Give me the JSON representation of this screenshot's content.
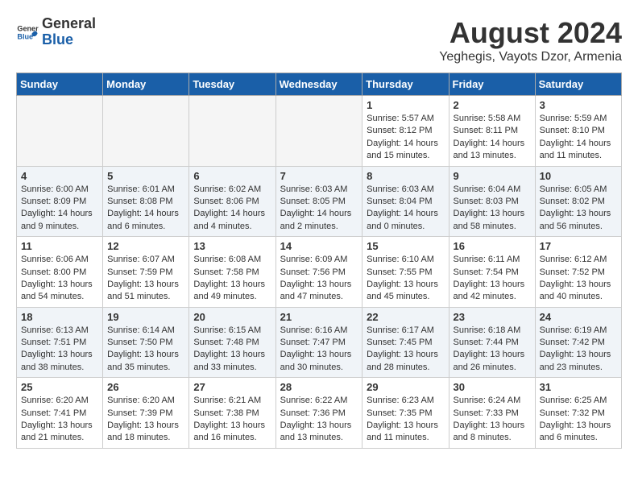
{
  "header": {
    "logo_general": "General",
    "logo_blue": "Blue",
    "title": "August 2024",
    "subtitle": "Yeghegis, Vayots Dzor, Armenia"
  },
  "weekdays": [
    "Sunday",
    "Monday",
    "Tuesday",
    "Wednesday",
    "Thursday",
    "Friday",
    "Saturday"
  ],
  "weeks": [
    [
      {
        "day": "",
        "info": ""
      },
      {
        "day": "",
        "info": ""
      },
      {
        "day": "",
        "info": ""
      },
      {
        "day": "",
        "info": ""
      },
      {
        "day": "1",
        "info": "Sunrise: 5:57 AM\nSunset: 8:12 PM\nDaylight: 14 hours and 15 minutes."
      },
      {
        "day": "2",
        "info": "Sunrise: 5:58 AM\nSunset: 8:11 PM\nDaylight: 14 hours and 13 minutes."
      },
      {
        "day": "3",
        "info": "Sunrise: 5:59 AM\nSunset: 8:10 PM\nDaylight: 14 hours and 11 minutes."
      }
    ],
    [
      {
        "day": "4",
        "info": "Sunrise: 6:00 AM\nSunset: 8:09 PM\nDaylight: 14 hours and 9 minutes."
      },
      {
        "day": "5",
        "info": "Sunrise: 6:01 AM\nSunset: 8:08 PM\nDaylight: 14 hours and 6 minutes."
      },
      {
        "day": "6",
        "info": "Sunrise: 6:02 AM\nSunset: 8:06 PM\nDaylight: 14 hours and 4 minutes."
      },
      {
        "day": "7",
        "info": "Sunrise: 6:03 AM\nSunset: 8:05 PM\nDaylight: 14 hours and 2 minutes."
      },
      {
        "day": "8",
        "info": "Sunrise: 6:03 AM\nSunset: 8:04 PM\nDaylight: 14 hours and 0 minutes."
      },
      {
        "day": "9",
        "info": "Sunrise: 6:04 AM\nSunset: 8:03 PM\nDaylight: 13 hours and 58 minutes."
      },
      {
        "day": "10",
        "info": "Sunrise: 6:05 AM\nSunset: 8:02 PM\nDaylight: 13 hours and 56 minutes."
      }
    ],
    [
      {
        "day": "11",
        "info": "Sunrise: 6:06 AM\nSunset: 8:00 PM\nDaylight: 13 hours and 54 minutes."
      },
      {
        "day": "12",
        "info": "Sunrise: 6:07 AM\nSunset: 7:59 PM\nDaylight: 13 hours and 51 minutes."
      },
      {
        "day": "13",
        "info": "Sunrise: 6:08 AM\nSunset: 7:58 PM\nDaylight: 13 hours and 49 minutes."
      },
      {
        "day": "14",
        "info": "Sunrise: 6:09 AM\nSunset: 7:56 PM\nDaylight: 13 hours and 47 minutes."
      },
      {
        "day": "15",
        "info": "Sunrise: 6:10 AM\nSunset: 7:55 PM\nDaylight: 13 hours and 45 minutes."
      },
      {
        "day": "16",
        "info": "Sunrise: 6:11 AM\nSunset: 7:54 PM\nDaylight: 13 hours and 42 minutes."
      },
      {
        "day": "17",
        "info": "Sunrise: 6:12 AM\nSunset: 7:52 PM\nDaylight: 13 hours and 40 minutes."
      }
    ],
    [
      {
        "day": "18",
        "info": "Sunrise: 6:13 AM\nSunset: 7:51 PM\nDaylight: 13 hours and 38 minutes."
      },
      {
        "day": "19",
        "info": "Sunrise: 6:14 AM\nSunset: 7:50 PM\nDaylight: 13 hours and 35 minutes."
      },
      {
        "day": "20",
        "info": "Sunrise: 6:15 AM\nSunset: 7:48 PM\nDaylight: 13 hours and 33 minutes."
      },
      {
        "day": "21",
        "info": "Sunrise: 6:16 AM\nSunset: 7:47 PM\nDaylight: 13 hours and 30 minutes."
      },
      {
        "day": "22",
        "info": "Sunrise: 6:17 AM\nSunset: 7:45 PM\nDaylight: 13 hours and 28 minutes."
      },
      {
        "day": "23",
        "info": "Sunrise: 6:18 AM\nSunset: 7:44 PM\nDaylight: 13 hours and 26 minutes."
      },
      {
        "day": "24",
        "info": "Sunrise: 6:19 AM\nSunset: 7:42 PM\nDaylight: 13 hours and 23 minutes."
      }
    ],
    [
      {
        "day": "25",
        "info": "Sunrise: 6:20 AM\nSunset: 7:41 PM\nDaylight: 13 hours and 21 minutes."
      },
      {
        "day": "26",
        "info": "Sunrise: 6:20 AM\nSunset: 7:39 PM\nDaylight: 13 hours and 18 minutes."
      },
      {
        "day": "27",
        "info": "Sunrise: 6:21 AM\nSunset: 7:38 PM\nDaylight: 13 hours and 16 minutes."
      },
      {
        "day": "28",
        "info": "Sunrise: 6:22 AM\nSunset: 7:36 PM\nDaylight: 13 hours and 13 minutes."
      },
      {
        "day": "29",
        "info": "Sunrise: 6:23 AM\nSunset: 7:35 PM\nDaylight: 13 hours and 11 minutes."
      },
      {
        "day": "30",
        "info": "Sunrise: 6:24 AM\nSunset: 7:33 PM\nDaylight: 13 hours and 8 minutes."
      },
      {
        "day": "31",
        "info": "Sunrise: 6:25 AM\nSunset: 7:32 PM\nDaylight: 13 hours and 6 minutes."
      }
    ]
  ]
}
